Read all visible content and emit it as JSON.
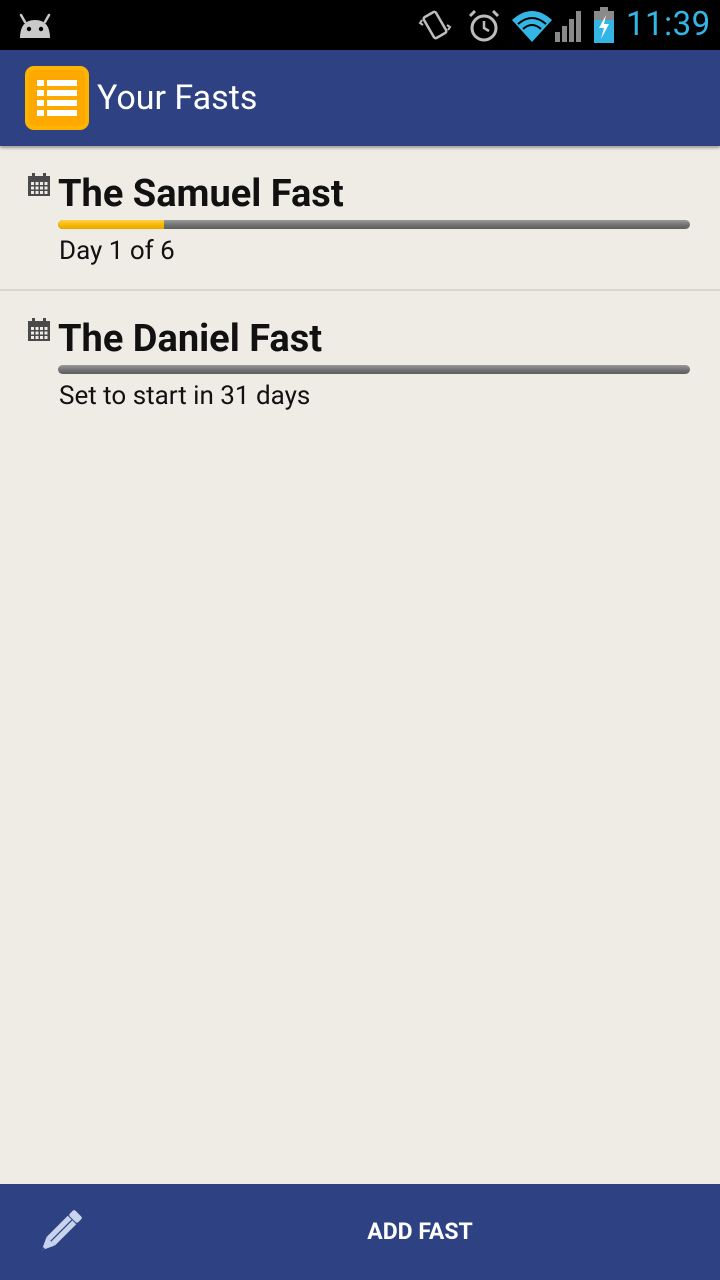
{
  "status_bar": {
    "time": "11:39",
    "time_color": "#33b5e5",
    "icons": [
      "android-icon",
      "vibrate-icon",
      "alarm-icon",
      "wifi-icon",
      "signal-icon",
      "battery-charging-icon"
    ]
  },
  "action_bar": {
    "title": "Your Fasts",
    "icon": "list-icon",
    "background_color": "#2e4283",
    "icon_color": "#ffb400"
  },
  "fasts": [
    {
      "name": "The Samuel Fast",
      "status": "Day 1 of 6",
      "progress": 0.167,
      "icon": "calendar-icon"
    },
    {
      "name": "The Daniel Fast",
      "status": "Set to start in 31 days",
      "progress": 0,
      "icon": "calendar-icon"
    }
  ],
  "bottom_bar": {
    "button_label": "ADD FAST",
    "icon": "pencil-icon"
  }
}
